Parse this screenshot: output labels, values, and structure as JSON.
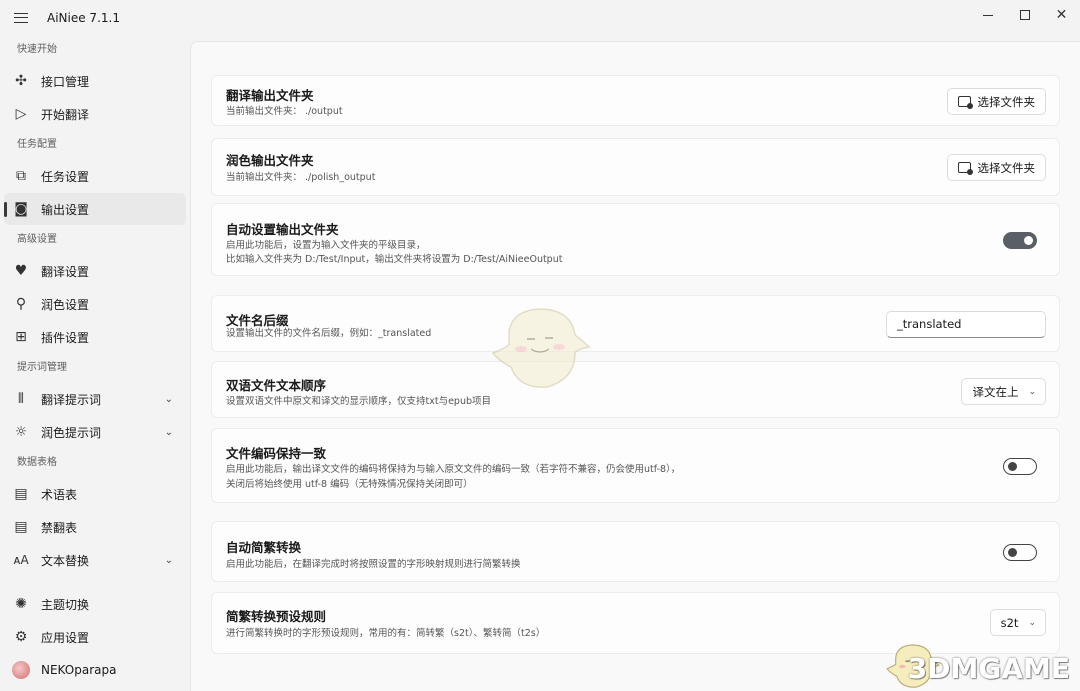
{
  "window": {
    "app_title": "AiNiee 7.1.1"
  },
  "sidebar": {
    "groups": [
      {
        "label": "快速开始"
      },
      {
        "label": "任务配置"
      },
      {
        "label": "高级设置"
      },
      {
        "label": "提示词管理"
      },
      {
        "label": "数据表格"
      }
    ],
    "items": [
      {
        "label": "接口管理",
        "icon": "api-nodes-icon"
      },
      {
        "label": "开始翻译",
        "icon": "play-icon"
      },
      {
        "label": "任务设置",
        "icon": "task-settings-icon"
      },
      {
        "label": "输出设置",
        "icon": "output-settings-icon",
        "active": true
      },
      {
        "label": "翻译设置",
        "icon": "heart-note-icon"
      },
      {
        "label": "润色设置",
        "icon": "brush-icon"
      },
      {
        "label": "插件设置",
        "icon": "plugin-grid-icon"
      },
      {
        "label": "翻译提示词",
        "icon": "library-icon",
        "expandable": true
      },
      {
        "label": "润色提示词",
        "icon": "bulb-icon",
        "expandable": true
      },
      {
        "label": "术语表",
        "icon": "book-icon"
      },
      {
        "label": "禁翻表",
        "icon": "book-icon"
      },
      {
        "label": "文本替换",
        "icon": "text-font-icon",
        "expandable": true
      },
      {
        "label": "主题切换",
        "icon": "sun-icon"
      },
      {
        "label": "应用设置",
        "icon": "gear-icon"
      },
      {
        "label": "NEKOparapa",
        "icon": "avatar"
      }
    ]
  },
  "settings": {
    "translate_output": {
      "title": "翻译输出文件夹",
      "desc": "当前输出文件夹： ./output",
      "button": "选择文件夹"
    },
    "polish_output": {
      "title": "润色输出文件夹",
      "desc": "当前输出文件夹： ./polish_output",
      "button": "选择文件夹"
    },
    "auto_output": {
      "title": "自动设置输出文件夹",
      "desc1": "启用此功能后，设置为输入文件夹的平级目录，",
      "desc2": "比如输入文件夹为 D:/Test/Input，输出文件夹将设置为 D:/Test/AiNieeOutput",
      "enabled": true
    },
    "file_suffix": {
      "title": "文件名后缀",
      "desc": "设置输出文件的文件名后缀，例如：_translated",
      "value": "_translated"
    },
    "bilingual_order": {
      "title": "双语文件文本顺序",
      "desc": "设置双语文件中原文和译文的显示顺序，仅支持txt与epub项目",
      "selected": "译文在上"
    },
    "keep_encoding": {
      "title": "文件编码保持一致",
      "desc1": "启用此功能后，输出译文文件的编码将保持为与输入原文文件的编码一致（若字符不兼容，仍会使用utf-8），",
      "desc2": "关闭后将始终使用 utf-8 编码（无特殊情况保持关闭即可）",
      "enabled": false
    },
    "auto_convert": {
      "title": "自动简繁转换",
      "desc": "启用此功能后，在翻译完成时将按照设置的字形映射规则进行简繁转换",
      "enabled": false
    },
    "convert_preset": {
      "title": "简繁转换预设规则",
      "desc": "进行简繁转换时的字形预设规则，常用的有：简转繁（s2t）、繁转简（t2s）",
      "selected": "s2t"
    }
  },
  "watermark": "3DMGAME"
}
